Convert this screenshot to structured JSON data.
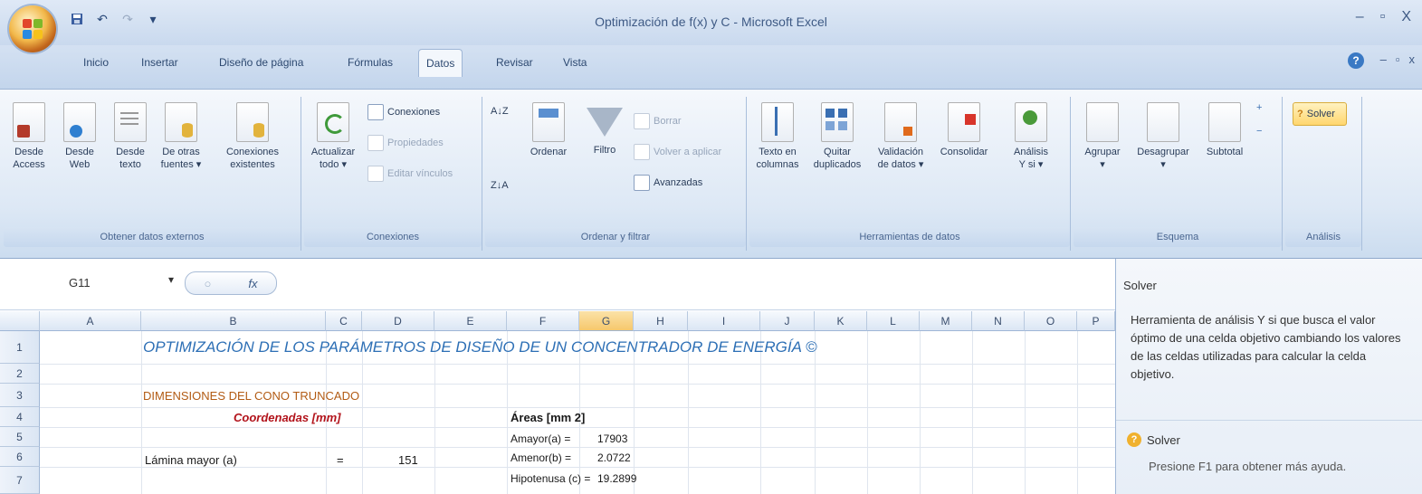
{
  "window": {
    "title": "Optimización de f(x) y C - Microsoft Excel",
    "controls": [
      "–",
      "▫",
      "X"
    ]
  },
  "quick_access": [
    "save-icon",
    "undo-icon",
    "redo-icon",
    "customize-icon"
  ],
  "tabs": [
    {
      "label": "Inicio",
      "active": false
    },
    {
      "label": "Insertar",
      "active": false
    },
    {
      "label": "Diseño de página",
      "active": false
    },
    {
      "label": "Fórmulas",
      "active": false
    },
    {
      "label": "Datos",
      "active": true
    },
    {
      "label": "Revisar",
      "active": false
    },
    {
      "label": "Vista",
      "active": false
    }
  ],
  "ribbon": {
    "groups": {
      "external": {
        "caption": "Obtener datos externos",
        "buttons": [
          {
            "line1": "Desde",
            "line2": "Access"
          },
          {
            "line1": "Desde",
            "line2": "Web"
          },
          {
            "line1": "Desde",
            "line2": "texto"
          },
          {
            "line1": "De otras",
            "line2": "fuentes ▾"
          },
          {
            "line1": "Conexiones",
            "line2": "existentes"
          }
        ]
      },
      "connections": {
        "caption": "Conexiones",
        "refresh_line1": "Actualizar",
        "refresh_line2": "todo ▾",
        "small": [
          "Conexiones",
          "Propiedades",
          "Editar vínculos"
        ]
      },
      "sort": {
        "caption": "Ordenar y filtrar",
        "sort_label": "Ordenar",
        "filter_label": "Filtro",
        "small": [
          "Borrar",
          "Volver a aplicar",
          "Avanzadas"
        ]
      },
      "tools": {
        "caption": "Herramientas de datos",
        "buttons": [
          {
            "line1": "Texto en",
            "line2": "columnas"
          },
          {
            "line1": "Quitar",
            "line2": "duplicados"
          },
          {
            "line1": "Validación",
            "line2": "de datos ▾"
          },
          {
            "line1": "Consolidar",
            "line2": ""
          },
          {
            "line1": "Análisis",
            "line2": "Y si ▾"
          }
        ]
      },
      "outline": {
        "caption": "Esquema",
        "buttons": [
          {
            "line1": "Agrupar",
            "line2": "▾"
          },
          {
            "line1": "Desagrupar",
            "line2": "▾"
          },
          {
            "line1": "Subtotal",
            "line2": ""
          }
        ]
      },
      "analysis": {
        "caption": "Análisis",
        "solver_label": "Solver"
      }
    }
  },
  "formula_bar": {
    "cell_ref": "G11",
    "fx": "fx"
  },
  "sheet": {
    "columns": [
      "A",
      "B",
      "C",
      "D",
      "E",
      "F",
      "G",
      "H",
      "I",
      "J",
      "K",
      "L",
      "M",
      "N",
      "O",
      "P"
    ],
    "selected_column": "G",
    "rows": [
      "1",
      "2",
      "3",
      "4",
      "5",
      "6",
      "7"
    ],
    "cells": {
      "title": "OPTIMIZACIÓN DE LOS PARÁMETROS DE DISEÑO DE UN CONCENTRADOR DE ENERGÍA ©",
      "section": "DIMENSIONES DEL CONO TRUNCADO",
      "coord_header": "Coordenadas [mm]",
      "areas_header": "Áreas [mm 2]",
      "row6_label": "Lámina mayor (a)",
      "row6_symbol": "=",
      "row6_value": "151",
      "area1_label": "Amayor(a) =",
      "area1_value": "17903",
      "area2_label": "Amenor(b) =",
      "area2_value": "2.0722",
      "area3_label": "Hipotenusa (c) =",
      "area3_value": "19.2899"
    }
  },
  "task_pane": {
    "title": "Solver",
    "description": "Herramienta de análisis Y si que busca el valor óptimo de una celda objetivo cambiando los valores de las celdas utilizadas para calcular la celda objetivo.",
    "help_label": "Solver",
    "hint": "Presione F1 para obtener más ayuda."
  }
}
